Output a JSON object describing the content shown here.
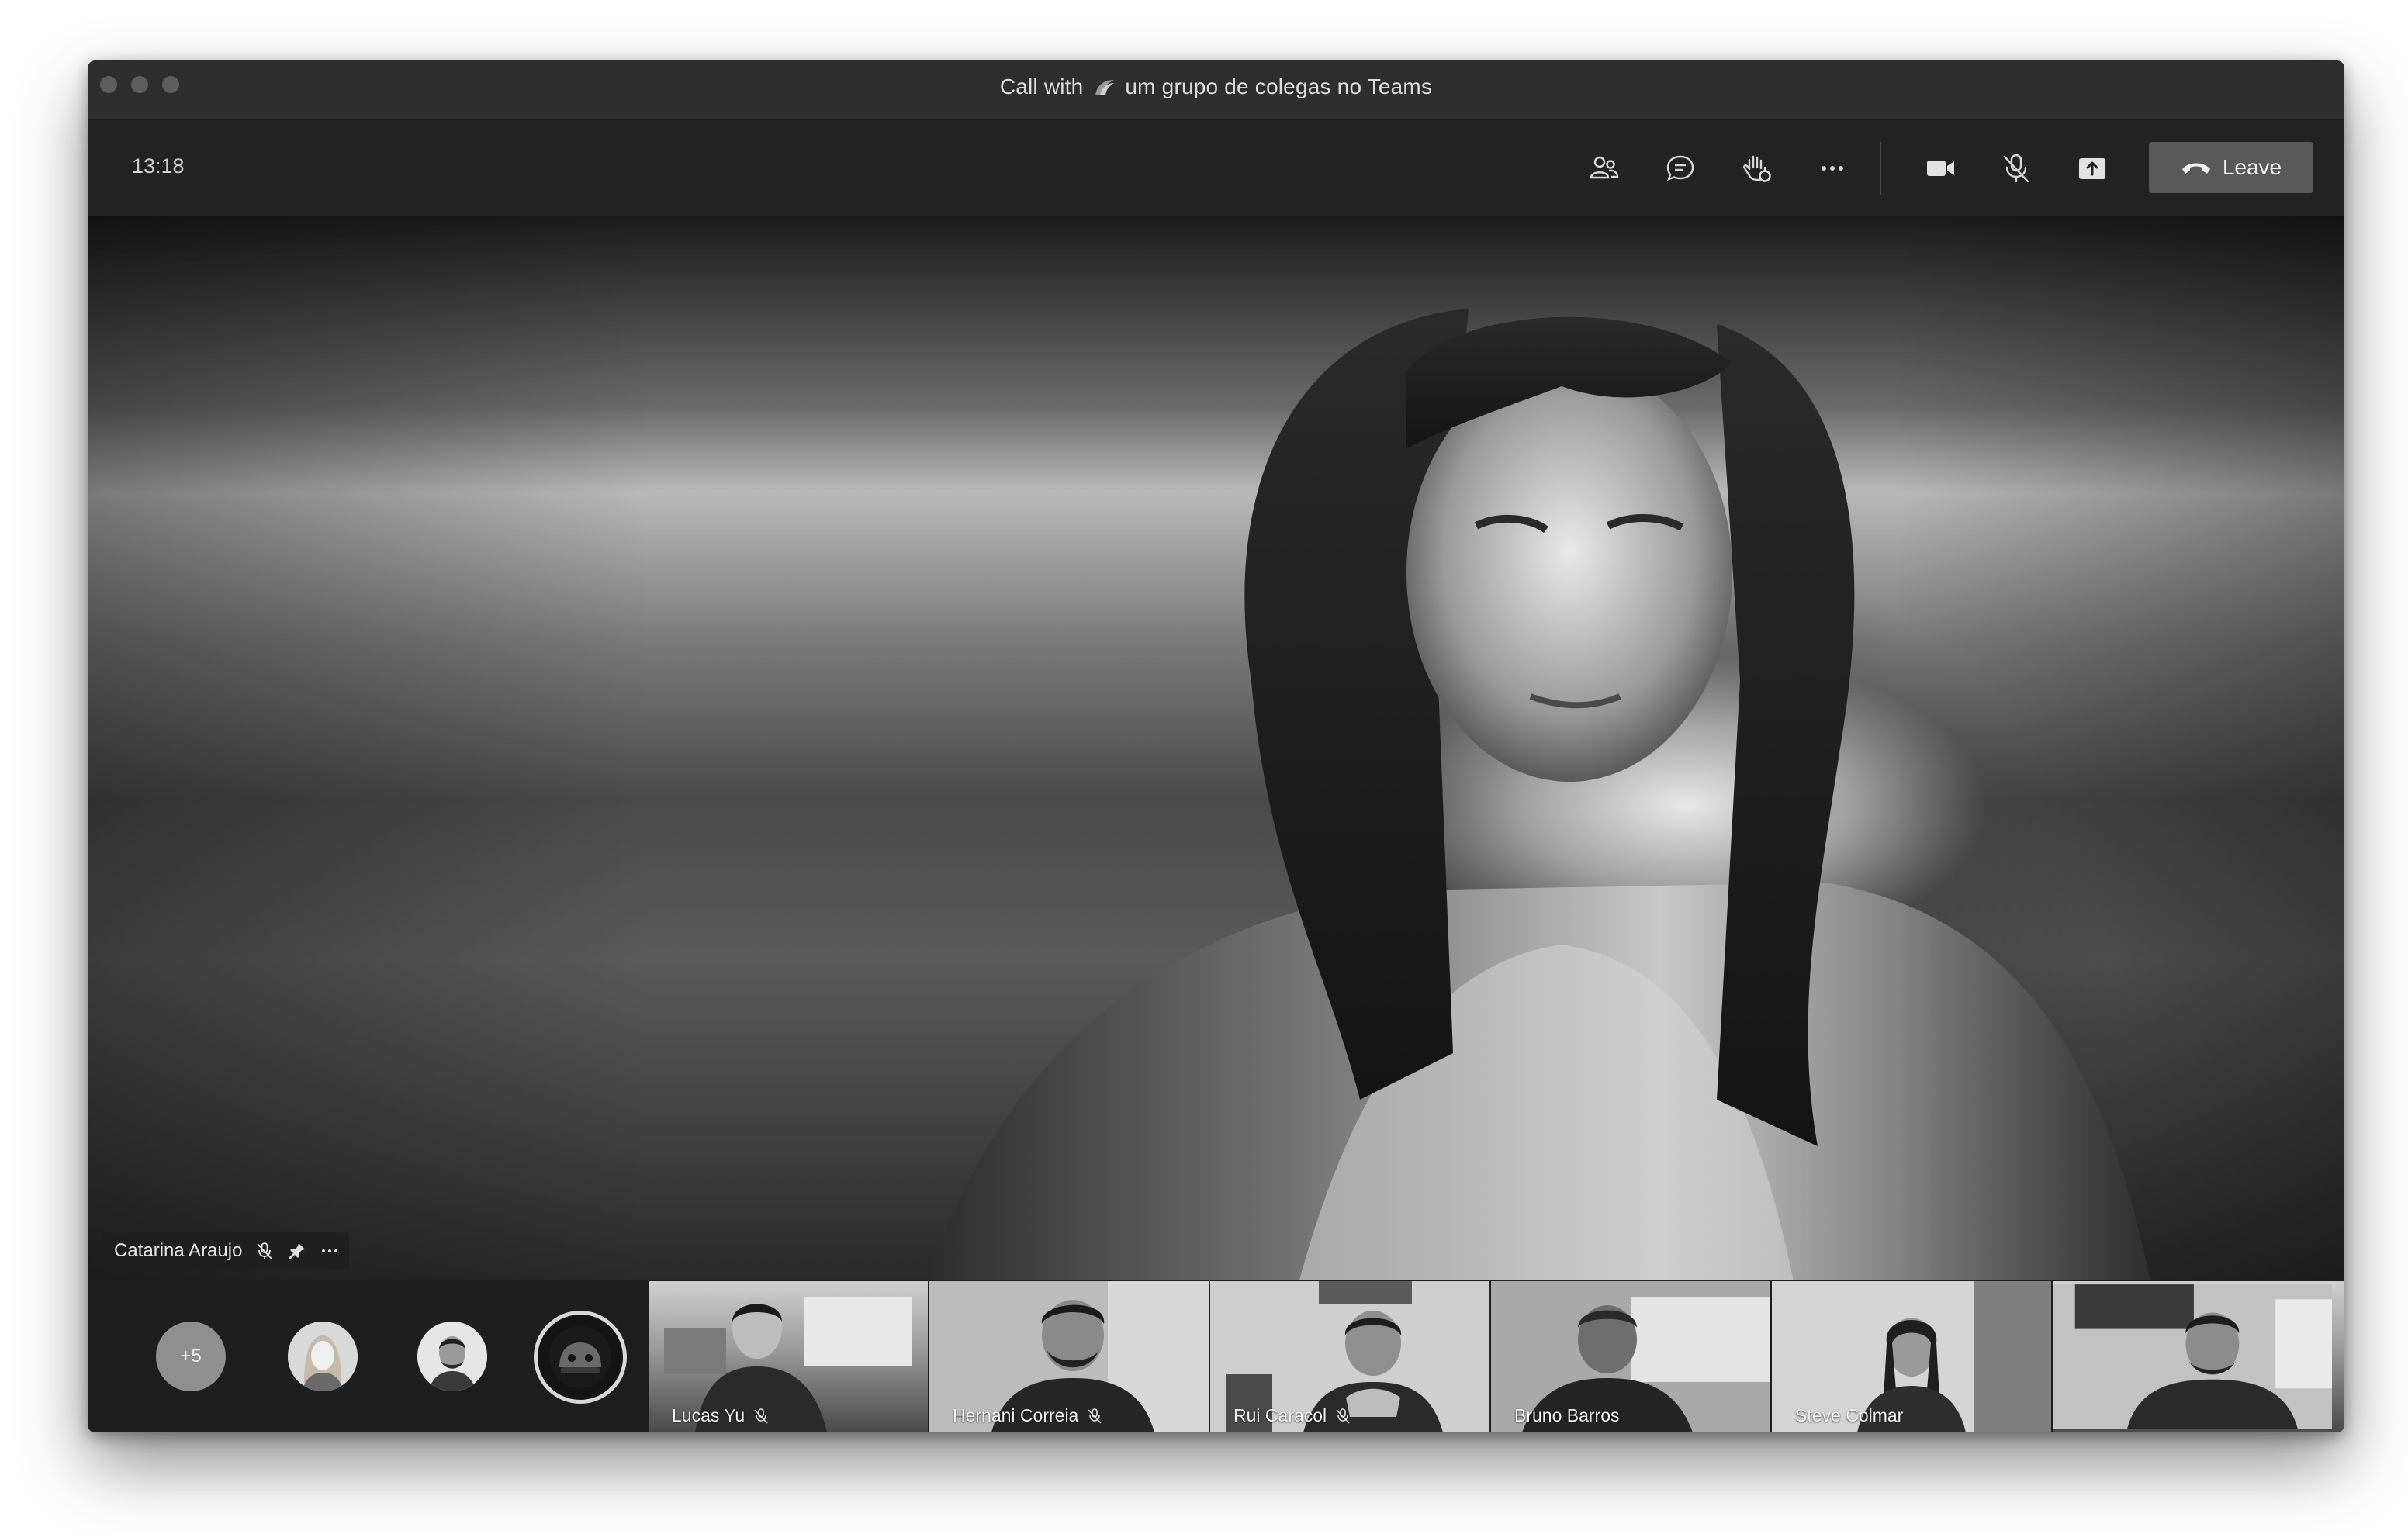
{
  "window": {
    "title_prefix": "Call with",
    "title_suffix": "um grupo de colegas no Teams",
    "title_icon": "team-logo-icon"
  },
  "toolbar": {
    "clock": "13:18",
    "buttons": [
      {
        "name": "participants-button",
        "icon": "people-icon"
      },
      {
        "name": "chat-button",
        "icon": "chat-bubble-icon"
      },
      {
        "name": "raise-hand-button",
        "icon": "hand-icon"
      },
      {
        "name": "more-actions-button",
        "icon": "ellipsis-icon"
      },
      {
        "name": "camera-button",
        "icon": "video-camera-icon"
      },
      {
        "name": "mic-button",
        "icon": "mic-off-icon"
      },
      {
        "name": "share-button",
        "icon": "share-tray-icon"
      }
    ],
    "leave_label": "Leave",
    "leave_icon": "hang-up-icon"
  },
  "main_video": {
    "speaker_name": "Catarina Araujo",
    "muted": true,
    "pinned": true
  },
  "strip": {
    "overflow_count": "+5",
    "participants": [
      {
        "name": "Lucas Yu",
        "muted": true
      },
      {
        "name": "Hernani Correia",
        "muted": true
      },
      {
        "name": "Rui Caracol",
        "muted": true
      },
      {
        "name": "Bruno Barros",
        "muted": false
      },
      {
        "name": "Steve Colmar",
        "muted": false
      },
      {
        "name": "",
        "muted": false
      }
    ]
  },
  "colors": {
    "titlebar": "#2e2e2e",
    "toolbar": "#232323",
    "leave_button": "#595959",
    "strip": "#1e1e1e"
  }
}
